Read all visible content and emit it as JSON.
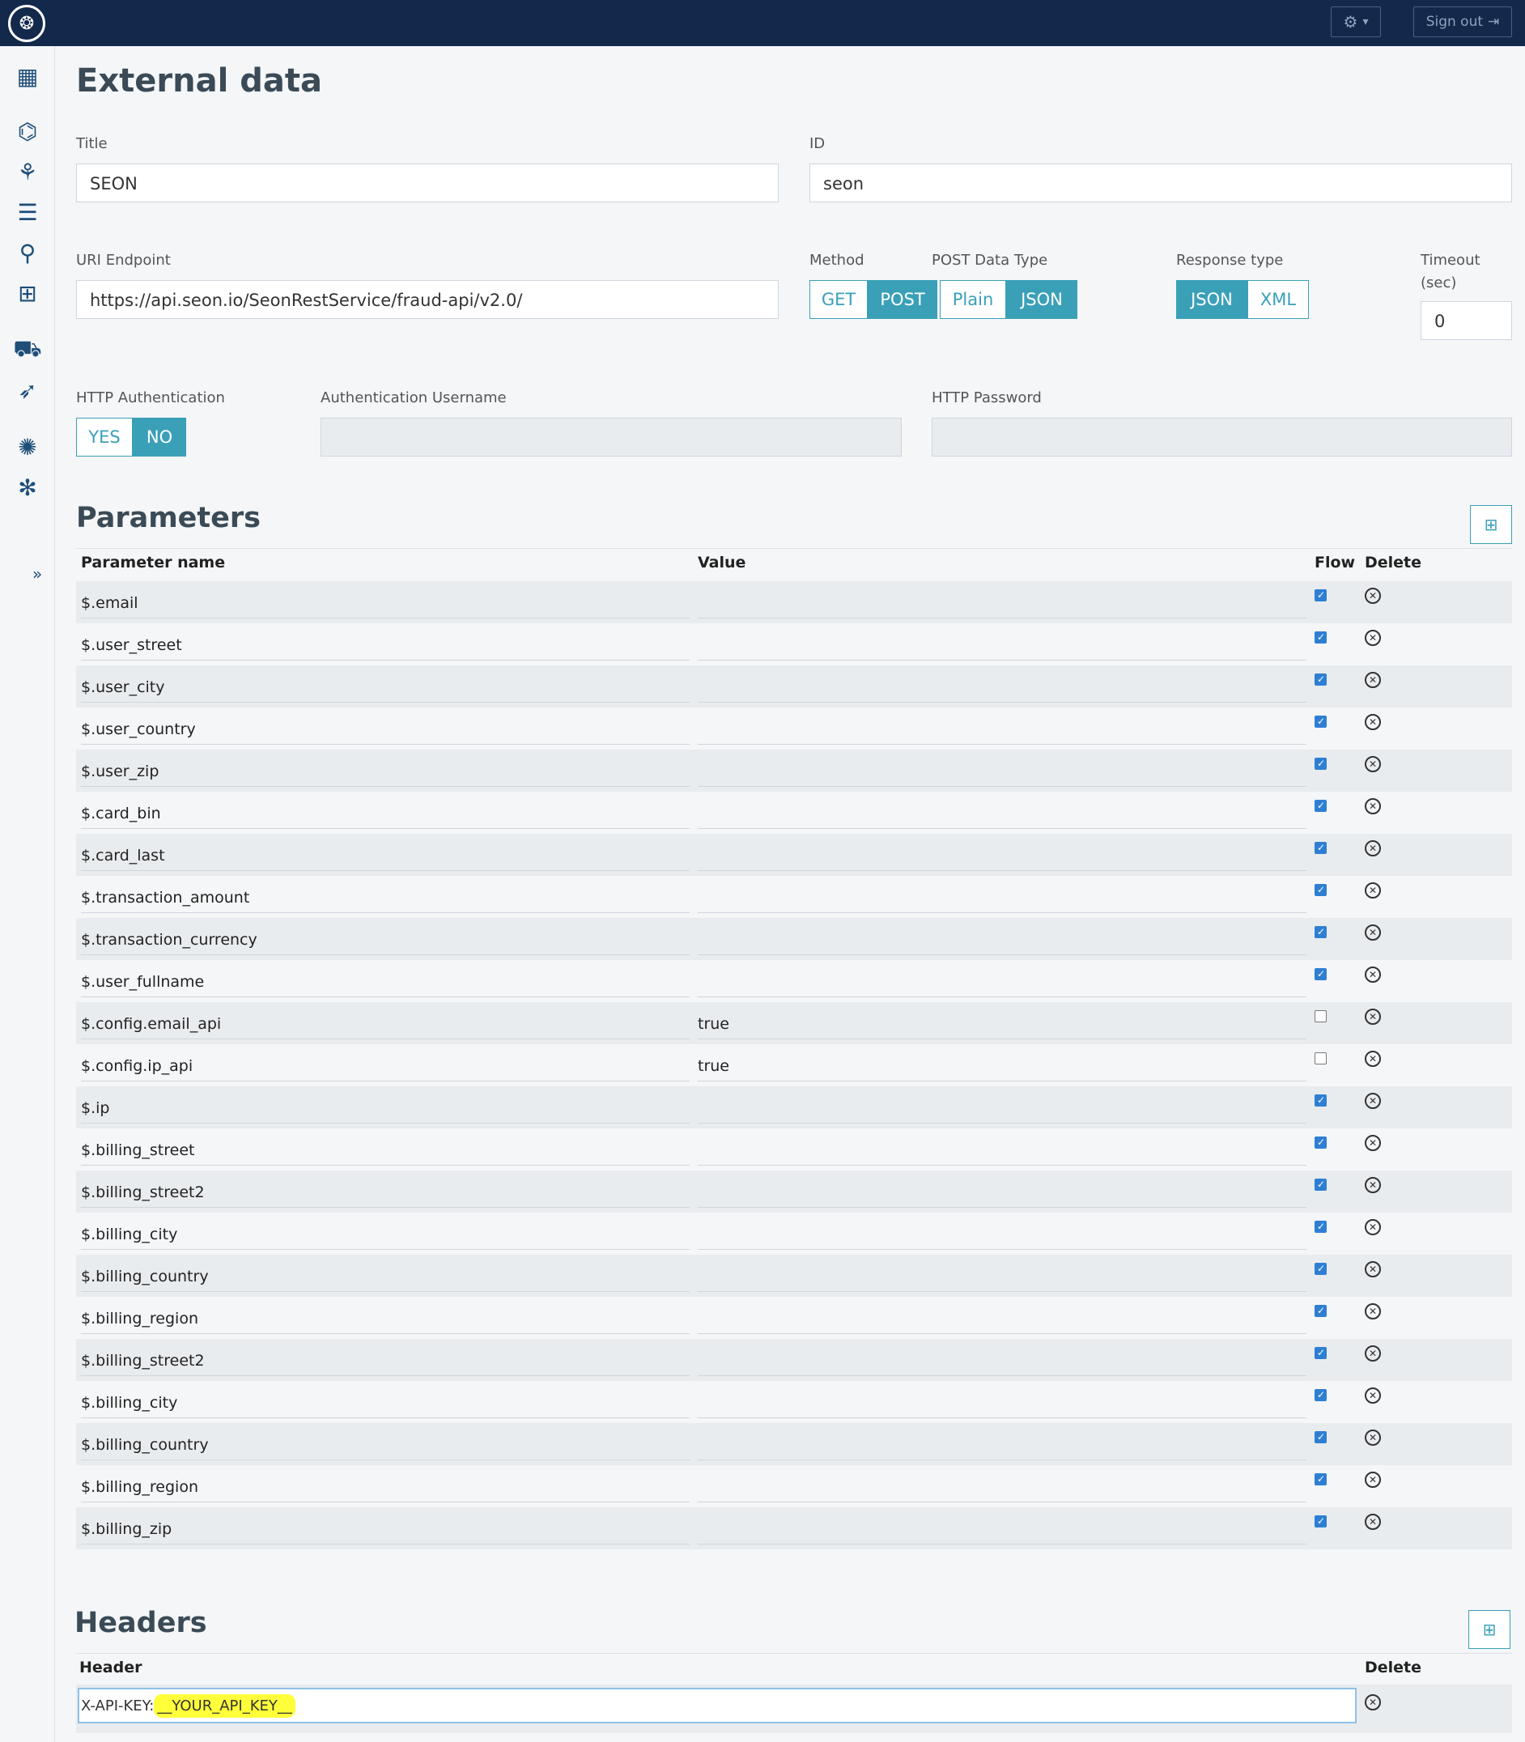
{
  "topbar": {
    "logo_glyph": "❂",
    "gear_glyph": "⚙",
    "caret": "▾",
    "signout_label": "Sign out",
    "signout_glyph": "⇥"
  },
  "sidebar": {
    "icons": [
      {
        "name": "dashboard-icon",
        "glyph": "▦"
      },
      {
        "name": "hierarchy-icon",
        "glyph": "⌬"
      },
      {
        "name": "flow-icon",
        "glyph": "⚘"
      },
      {
        "name": "database-icon",
        "glyph": "☰"
      },
      {
        "name": "search-settings-icon",
        "glyph": "⚲"
      },
      {
        "name": "grid-icon",
        "glyph": "⊞"
      },
      {
        "name": "truck-icon",
        "glyph": "⛟"
      },
      {
        "name": "rocket-icon",
        "glyph": "➶"
      },
      {
        "name": "virus-icon",
        "glyph": "✺"
      },
      {
        "name": "network-icon",
        "glyph": "✻"
      }
    ],
    "expand": "»"
  },
  "page": {
    "title": "External data"
  },
  "form": {
    "title_label": "Title",
    "title_value": "SEON",
    "id_label": "ID",
    "id_value": "seon",
    "uri_label": "URI Endpoint",
    "uri_value": "https://api.seon.io/SeonRestService/fraud-api/v2.0/",
    "method_label": "Method",
    "method_get": "GET",
    "method_post": "POST",
    "post_type_label": "POST Data Type",
    "post_plain": "Plain",
    "post_json": "JSON",
    "response_label": "Response type",
    "response_json": "JSON",
    "response_xml": "XML",
    "timeout_label_1": "Timeout",
    "timeout_label_2": "(sec)",
    "timeout_value": "0",
    "auth_label": "HTTP Authentication",
    "auth_yes": "YES",
    "auth_no": "NO",
    "auth_user_label": "Authentication Username",
    "auth_pass_label": "HTTP Password"
  },
  "parameters": {
    "title": "Parameters",
    "add_glyph": "⊞",
    "columns": {
      "name": "Parameter name",
      "value": "Value",
      "flow": "Flow",
      "delete": "Delete"
    },
    "delete_glyph": "✕",
    "rows": [
      {
        "name": "$.email",
        "value": "",
        "flow": true
      },
      {
        "name": "$.user_street",
        "value": "",
        "flow": true
      },
      {
        "name": "$.user_city",
        "value": "",
        "flow": true
      },
      {
        "name": "$.user_country",
        "value": "",
        "flow": true
      },
      {
        "name": "$.user_zip",
        "value": "",
        "flow": true
      },
      {
        "name": "$.card_bin",
        "value": "",
        "flow": true
      },
      {
        "name": "$.card_last",
        "value": "",
        "flow": true
      },
      {
        "name": "$.transaction_amount",
        "value": "",
        "flow": true
      },
      {
        "name": "$.transaction_currency",
        "value": "",
        "flow": true
      },
      {
        "name": "$.user_fullname",
        "value": "",
        "flow": true
      },
      {
        "name": "$.config.email_api",
        "value": "true",
        "flow": false
      },
      {
        "name": "$.config.ip_api",
        "value": "true",
        "flow": false
      },
      {
        "name": "$.ip",
        "value": "",
        "flow": true
      },
      {
        "name": "$.billing_street",
        "value": "",
        "flow": true
      },
      {
        "name": "$.billing_street2",
        "value": "",
        "flow": true
      },
      {
        "name": "$.billing_city",
        "value": "",
        "flow": true
      },
      {
        "name": "$.billing_country",
        "value": "",
        "flow": true
      },
      {
        "name": "$.billing_region",
        "value": "",
        "flow": true
      },
      {
        "name": "$.billing_street2",
        "value": "",
        "flow": true
      },
      {
        "name": "$.billing_city",
        "value": "",
        "flow": true
      },
      {
        "name": "$.billing_country",
        "value": "",
        "flow": true
      },
      {
        "name": "$.billing_region",
        "value": "",
        "flow": true
      },
      {
        "name": "$.billing_zip",
        "value": "",
        "flow": true
      }
    ]
  },
  "headers": {
    "title": "Headers",
    "add_glyph": "⊞",
    "col_header": "Header",
    "col_delete": "Delete",
    "header_key": "X-API-KEY:",
    "header_value": "__YOUR_API_KEY__",
    "delete_glyph": "✕"
  }
}
